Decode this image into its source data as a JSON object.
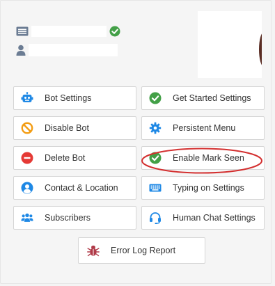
{
  "colors": {
    "blue": "#1e88e5",
    "green": "#43a047",
    "orange": "#f39c12",
    "red": "#e53935",
    "purple_red": "#b03a48",
    "annotation": "#d32f2f"
  },
  "profile": {
    "page_icon": "id-card-icon",
    "user_icon": "user-icon",
    "verified_icon": "check-circle-icon"
  },
  "buttons": {
    "bot_settings": {
      "label": "Bot Settings",
      "icon": "robot-icon"
    },
    "get_started": {
      "label": "Get Started Settings",
      "icon": "check-circle-icon"
    },
    "disable_bot": {
      "label": "Disable Bot",
      "icon": "ban-icon"
    },
    "persistent_menu": {
      "label": "Persistent Menu",
      "icon": "gear-icon"
    },
    "delete_bot": {
      "label": "Delete Bot",
      "icon": "minus-circle-icon"
    },
    "mark_seen": {
      "label": "Enable Mark Seen",
      "icon": "check-circle-icon"
    },
    "contact_location": {
      "label": "Contact & Location",
      "icon": "user-circle-icon"
    },
    "typing_on": {
      "label": "Typing on Settings",
      "icon": "keyboard-icon"
    },
    "subscribers": {
      "label": "Subscribers",
      "icon": "users-icon"
    },
    "human_chat": {
      "label": "Human Chat Settings",
      "icon": "headset-icon"
    },
    "error_log": {
      "label": "Error Log Report",
      "icon": "bug-icon"
    }
  }
}
